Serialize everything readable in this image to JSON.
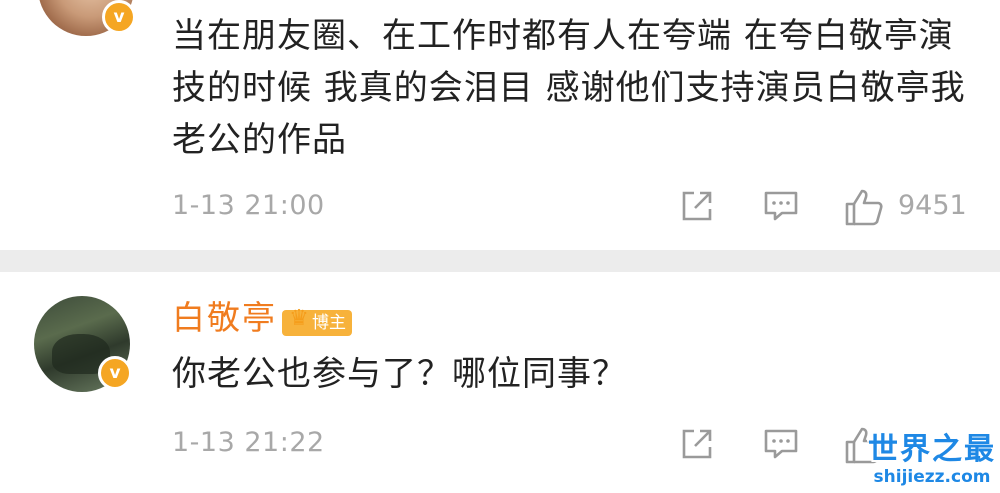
{
  "comments": [
    {
      "avatar_icon": "user-avatar",
      "verified_icon": "verified-badge-icon",
      "verified_glyph": "v",
      "text": "当在朋友圈、在工作时都有人在夸端  在夸白敬亭演技的时候  我真的会泪目  感谢他们支持演员白敬亭我老公的作品",
      "time": "1-13 21:00",
      "likes": "9451"
    },
    {
      "avatar_icon": "user-avatar",
      "verified_icon": "verified-badge-icon",
      "verified_glyph": "v",
      "username": "白敬亭",
      "badge": "博主",
      "text": "你老公也参与了？哪位同事？",
      "time": "1-13 21:22",
      "likes": ""
    }
  ],
  "icons": {
    "share": "share-icon",
    "reply": "comment-icon",
    "like": "thumbs-up-icon",
    "crown": "crown-icon"
  },
  "colors": {
    "username": "#f07c1f",
    "badge": "#f7b23b",
    "verified": "#f5a623",
    "meta": "#a8a8a8",
    "divider": "#ececec",
    "watermark": "#1e88e5"
  },
  "watermark": {
    "title": "世界之最",
    "url": "shijiezz.com"
  }
}
